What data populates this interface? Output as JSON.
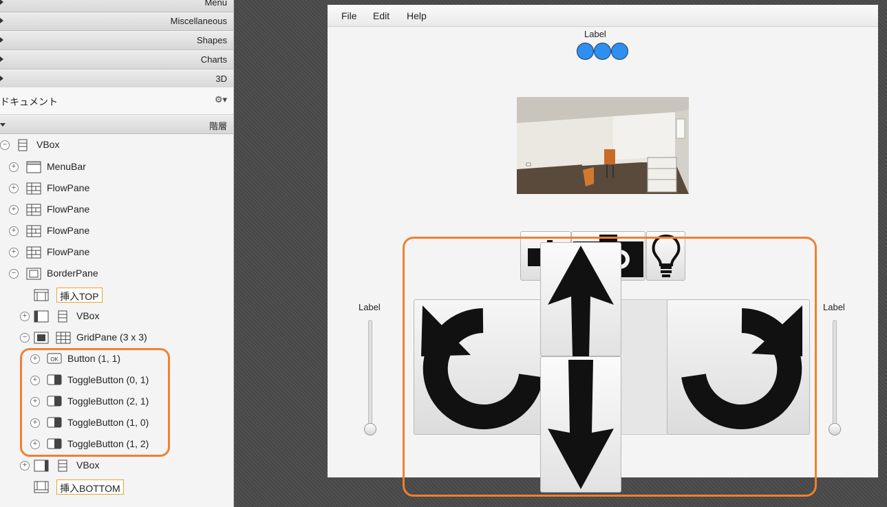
{
  "library": {
    "sections": [
      {
        "label": "Menu",
        "expanded": false
      },
      {
        "label": "Miscellaneous",
        "expanded": false
      },
      {
        "label": "Shapes",
        "expanded": false
      },
      {
        "label": "Charts",
        "expanded": false
      },
      {
        "label": "3D",
        "expanded": false
      }
    ]
  },
  "document": {
    "title": "ドキュメント",
    "gear_icon": "gear-icon",
    "hierarchy_label": "階層"
  },
  "tree": {
    "root": "VBox",
    "menubar": "MenuBar",
    "flowpane": "FlowPane",
    "borderpane": "BorderPane",
    "insert_top": "挿入TOP",
    "vbox_left": "VBox",
    "gridpane": "GridPane (3 x 3)",
    "button_1_1": "Button (1, 1)",
    "toggle_0_1": "ToggleButton (0, 1)",
    "toggle_2_1": "ToggleButton (2, 1)",
    "toggle_1_0": "ToggleButton (1, 0)",
    "toggle_1_2": "ToggleButton (1, 2)",
    "vbox_right": "VBox",
    "insert_bottom": "挿入BOTTOM",
    "ok_icon_text": "OK"
  },
  "preview": {
    "menus": [
      "File",
      "Edit",
      "Help"
    ],
    "top_label": "Label",
    "left_slider_label": "Label",
    "right_slider_label": "Label",
    "left_slider_value": 0,
    "right_slider_value": 0,
    "dot_color": "#2e8ff0",
    "highlight_color": "#f08030"
  }
}
